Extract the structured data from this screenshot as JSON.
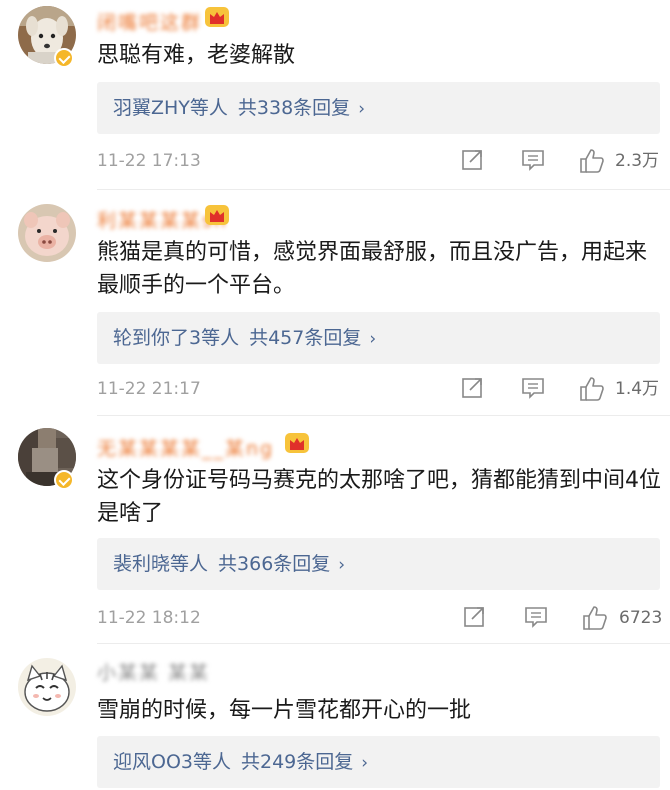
{
  "comments": [
    {
      "name": "闭嘴吧这群",
      "text": "思聪有难，老婆解散",
      "reply_users": "羽翼ZHY等人",
      "reply_count": "共338条回复",
      "time": "11-22 17:13",
      "likes": "2.3万",
      "icons": [
        "share-icon",
        "comment-icon",
        "thumbs-up-icon"
      ]
    },
    {
      "name": "利某某某某sh",
      "text": "熊猫是真的可惜，感觉界面最舒服，而且没广告，用起来最顺手的一个平台。",
      "reply_users": "轮到你了3等人",
      "reply_count": "共457条回复",
      "time": "11-22 21:17",
      "likes": "1.4万",
      "icons": [
        "share-icon",
        "comment-icon",
        "thumbs-up-icon"
      ]
    },
    {
      "name": "无某某某某__某ng",
      "text": "这个身份证号码马赛克的太那啥了吧，猜都能猜到中间4位是啥了",
      "reply_users": "裴利晓等人",
      "reply_count": "共366条回复",
      "time": "11-22 18:12",
      "likes": "6723",
      "icons": [
        "share-icon",
        "comment-icon",
        "thumbs-up-icon"
      ]
    },
    {
      "name": "小某某  某某",
      "text": "雪崩的时候，每一片雪花都开心的一批",
      "reply_users": "迎风OO3等人",
      "reply_count": "共249条回复"
    }
  ],
  "colors": {
    "name_orange": "#ec7a34",
    "reply_blue": "#4c6792",
    "reply_bg": "#f2f2f2",
    "meta_grey": "#a0a0a0",
    "verified_gold": "#f5b72a"
  }
}
